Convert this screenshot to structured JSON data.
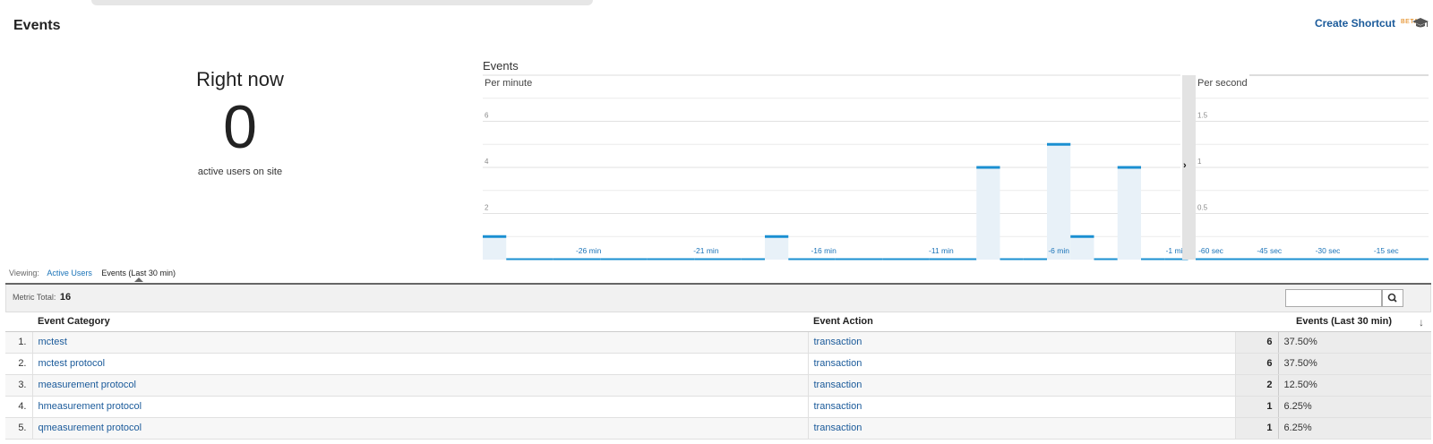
{
  "header": {
    "title": "Events",
    "shortcut_label": "Create Shortcut",
    "beta_label": "BETA",
    "help_icon": "graduation-cap-icon"
  },
  "right_now": {
    "title": "Right now",
    "count": "0",
    "caption": "active users on site"
  },
  "chart": {
    "heading": "Events",
    "per_minute_label": "Per minute",
    "per_second_label": "Per second"
  },
  "chart_data": [
    {
      "type": "bar",
      "xlabel": "",
      "ylabel": "",
      "x": [
        -30,
        -29,
        -28,
        -27,
        -26,
        -25,
        -24,
        -23,
        -22,
        -21,
        -20,
        -19,
        -18,
        -17,
        -16,
        -15,
        -14,
        -13,
        -12,
        -11,
        -10,
        -9,
        -8,
        -7,
        -6,
        -5,
        -4,
        -3,
        -2,
        -1
      ],
      "values": [
        1,
        0,
        0,
        0,
        0,
        0,
        0,
        0,
        0,
        0,
        0,
        0,
        1,
        0,
        0,
        0,
        0,
        0,
        0,
        0,
        0,
        4,
        0,
        0,
        5,
        1,
        0,
        4,
        0,
        0
      ],
      "ylim": [
        0,
        8
      ],
      "yticks": [
        2,
        4,
        6
      ],
      "xtick_labels": [
        "-26 min",
        "-21 min",
        "-16 min",
        "-11 min",
        "-6 min",
        "-1 min"
      ],
      "xtick_positions": [
        -26,
        -21,
        -16,
        -11,
        -6,
        -1
      ],
      "grid": true,
      "color": "#1a8fd1"
    },
    {
      "type": "bar",
      "xlabel": "",
      "ylabel": "",
      "x": [],
      "values": [],
      "ylim": [
        0,
        2
      ],
      "yticks": [
        0.5,
        1,
        1.5
      ],
      "ytick_labels": [
        "0.5",
        "1",
        "1.5"
      ],
      "xtick_labels": [
        "-60 sec",
        "-45 sec",
        "-30 sec",
        "-15 sec"
      ],
      "xtick_positions": [
        -60,
        -45,
        -30,
        -15
      ],
      "grid": true,
      "color": "#1a8fd1"
    }
  ],
  "viewing": {
    "label": "Viewing:",
    "tabs": [
      "Active Users",
      "Events (Last 30 min)"
    ]
  },
  "report": {
    "metric_label": "Metric Total:",
    "metric_total": "16",
    "search_value": "",
    "columns": [
      "Event Category",
      "Event Action",
      "Events (Last 30 min)"
    ],
    "rows": [
      {
        "rank": "1.",
        "category": "mctest",
        "action": "transaction",
        "events": "6",
        "pct": "37.50%"
      },
      {
        "rank": "2.",
        "category": "mctest protocol",
        "action": "transaction",
        "events": "6",
        "pct": "37.50%"
      },
      {
        "rank": "3.",
        "category": "measurement protocol",
        "action": "transaction",
        "events": "2",
        "pct": "12.50%"
      },
      {
        "rank": "4.",
        "category": "hmeasurement protocol",
        "action": "transaction",
        "events": "1",
        "pct": "6.25%"
      },
      {
        "rank": "5.",
        "category": "qmeasurement protocol",
        "action": "transaction",
        "events": "1",
        "pct": "6.25%"
      }
    ]
  }
}
